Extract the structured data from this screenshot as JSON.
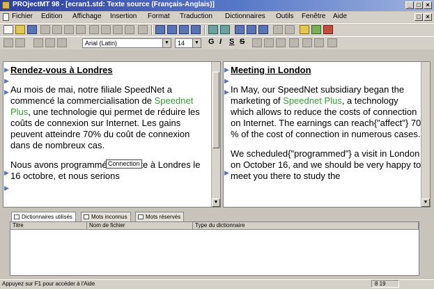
{
  "window": {
    "title": "PROjectMT 98 - [ecran1.std: Texte source (Français-Anglais)]"
  },
  "menu": [
    "Fichier",
    "Edition",
    "Affichage",
    "Insertion",
    "Format",
    "Traduction",
    "Dictionnaires",
    "Outils",
    "Fenêtre",
    "Aide"
  ],
  "format_bar": {
    "font": "Arial (Latin)",
    "size": "14",
    "bold": "G",
    "italic": "I",
    "underline": "S",
    "strike": "S"
  },
  "source_pane": {
    "title": "Rendez-vous à Londres",
    "para1": {
      "before": "Au mois de mai, notre filiale SpeedNet a commencé la commercialisation de ",
      "highlight": "Speednet Plus",
      "after": ", une technologie qui permet de réduire les coûts de connexion sur Internet. Les gains peuvent atteindre 70% du coût de connexion dans de nombreux cas."
    },
    "para2": "Nous avons programmé une visite à Londres le 16 octobre, et nous serions",
    "tooltip": "Connection"
  },
  "target_pane": {
    "title": "Meeting in London",
    "para1": {
      "before": "In May, our SpeedNet subsidiary began the marketing of ",
      "highlight": "Speednet Plus",
      "after": ", a technology which allows to reduce the costs of connection on Internet. The earnings can reach{\"affect\"} 70 % of the cost of connection in numerous cases."
    },
    "para2": "We scheduled{\"programmed\"} a visit in London on October 16, and we should be very happy to meet  you there to study the"
  },
  "bottom_tabs": [
    "Dictionnaires utilisés",
    "Mots inconnus",
    "Mots réservés"
  ],
  "dict_table": {
    "columns": [
      "Titre",
      "Nom de fichier",
      "Type du dictionnaire"
    ]
  },
  "status": {
    "message": "Appuyez sur F1 pour accéder à l'Aide",
    "position": "8  19"
  }
}
